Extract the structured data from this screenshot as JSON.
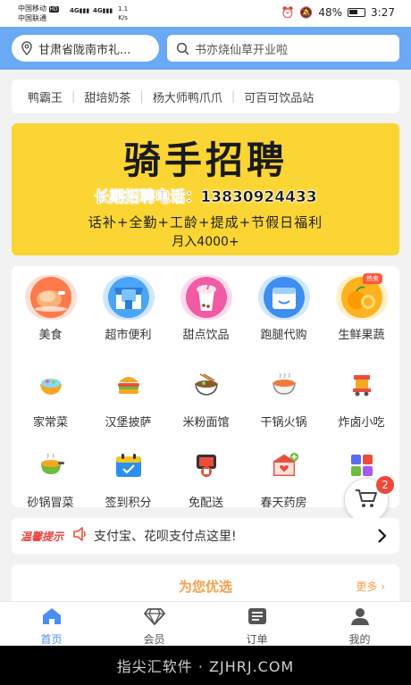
{
  "status_bar": {
    "carrier_1": "中国移动",
    "carrier_2": "中国联通",
    "hd_badge": "HD",
    "network_1": "4G",
    "network_2": "4G",
    "speed_value": "1.1",
    "speed_unit": "K/s",
    "battery": "48%",
    "time": "3:27"
  },
  "header": {
    "location": "甘肃省陇南市礼...",
    "search_placeholder": "书亦烧仙草开业啦",
    "accent_color": "#6aa9f3"
  },
  "brands": [
    "鸭霸王",
    "甜培奶茶",
    "杨大师鸭爪爪",
    "可百可饮品站"
  ],
  "banner": {
    "title": "骑手招聘",
    "phone": "长期招聘电话：13830924433",
    "benefits": "话补+全勤+工龄+提成+节假日福利",
    "salary": "月入4000+"
  },
  "categories": {
    "hot_tag": "热卖",
    "items": [
      {
        "label": "美食",
        "icon": "chicken-icon"
      },
      {
        "label": "超市便利",
        "icon": "store-icon"
      },
      {
        "label": "甜点饮品",
        "icon": "bubble-tea-icon"
      },
      {
        "label": "跑腿代购",
        "icon": "delivery-box-icon"
      },
      {
        "label": "生鲜果蔬",
        "icon": "orange-icon"
      },
      {
        "label": "家常菜",
        "icon": "rice-bowl-icon"
      },
      {
        "label": "汉堡披萨",
        "icon": "burger-icon"
      },
      {
        "label": "米粉面馆",
        "icon": "noodle-bowl-icon"
      },
      {
        "label": "干锅火锅",
        "icon": "hotpot-icon"
      },
      {
        "label": "炸卤小吃",
        "icon": "snack-cart-icon"
      },
      {
        "label": "砂锅冒菜",
        "icon": "clay-pot-icon"
      },
      {
        "label": "签到积分",
        "icon": "calendar-check-icon"
      },
      {
        "label": "免配送",
        "icon": "pickup-icon"
      },
      {
        "label": "春天药房",
        "icon": "medicine-box-icon"
      },
      {
        "label": "全部",
        "icon": "grid-icon"
      }
    ]
  },
  "cart": {
    "badge_count": "2"
  },
  "notice": {
    "tag": "温馨提示",
    "text": "支付宝、花呗支付点这里!"
  },
  "recommend": {
    "title": "为您优选",
    "more": "更多"
  },
  "tabbar": {
    "items": [
      {
        "label": "首页",
        "icon": "home-icon",
        "active": true
      },
      {
        "label": "会员",
        "icon": "diamond-icon",
        "active": false
      },
      {
        "label": "订单",
        "icon": "order-list-icon",
        "active": false
      },
      {
        "label": "我的",
        "icon": "user-icon",
        "active": false
      }
    ],
    "active_color": "#4b8ef1"
  },
  "watermark": "指尖汇软件 · ZJHRJ.COM"
}
